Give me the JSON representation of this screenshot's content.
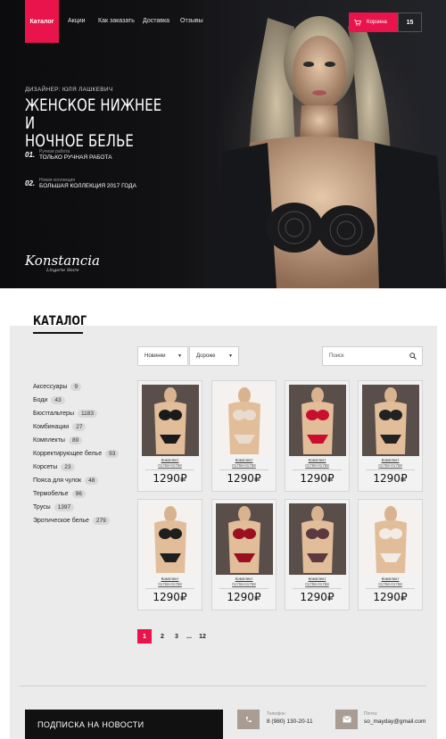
{
  "nav": {
    "catalog": "Каталог",
    "links": [
      "Акции",
      "Как заказать",
      "Доставка",
      "Отзывы"
    ],
    "cart_label": "Корзина",
    "cart_count": "15"
  },
  "hero": {
    "designer": "ДИЗАЙНЕР: ЮЛЯ ЛАШКЕВИЧ",
    "title_line1": "ЖЕНСКОЕ НИЖНЕЕ И",
    "title_line2": "НОЧНОЕ БЕЛЬЕ",
    "features": [
      {
        "num": "01.",
        "small": "Ручная работа",
        "big": "ТОЛЬКО РУЧНАЯ РАБОТА"
      },
      {
        "num": "02.",
        "small": "Новая коллекция",
        "big": "БОЛЬШАЯ КОЛЛЕКЦИЯ 2017 ГОДА"
      }
    ],
    "logo": "Konstancia",
    "logo_sub": "Lingerie Store"
  },
  "catalog": {
    "heading": "КАТАЛОГ",
    "sort1": "Новинки",
    "sort2": "Дороже",
    "search_placeholder": "Поиск",
    "categories": [
      {
        "label": "Аксессуары",
        "count": "9"
      },
      {
        "label": "Боди",
        "count": "43"
      },
      {
        "label": "Бюстгальтеры",
        "count": "1183"
      },
      {
        "label": "Комбинации",
        "count": "27"
      },
      {
        "label": "Комплекты",
        "count": "89"
      },
      {
        "label": "Корректирующее белье",
        "count": "93"
      },
      {
        "label": "Корсеты",
        "count": "23"
      },
      {
        "label": "Пояса для чулок",
        "count": "48"
      },
      {
        "label": "Термобелье",
        "count": "96"
      },
      {
        "label": "Трусы",
        "count": "1397"
      },
      {
        "label": "Эротическое белье",
        "count": "279"
      }
    ],
    "products": [
      {
        "name": "Комплект",
        "sku": "01758-01758",
        "price": "1290₽",
        "color": "#1a1a1a"
      },
      {
        "name": "Комплект",
        "sku": "01758-01758",
        "price": "1290₽",
        "color": "#e9dccf"
      },
      {
        "name": "Комплект",
        "sku": "01758-01758",
        "price": "1290₽",
        "color": "#c8102e"
      },
      {
        "name": "Комплект",
        "sku": "01758-01758",
        "price": "1290₽",
        "color": "#222222"
      },
      {
        "name": "Комплект",
        "sku": "01758-01758",
        "price": "1290₽",
        "color": "#1e1e1e"
      },
      {
        "name": "Комплект",
        "sku": "01758-01758",
        "price": "1290₽",
        "color": "#9b1020"
      },
      {
        "name": "Комплект",
        "sku": "01758-01758",
        "price": "1290₽",
        "color": "#5b3a3f"
      },
      {
        "name": "Комплект",
        "sku": "01758-01758",
        "price": "1290₽",
        "color": "#f1ece6"
      }
    ],
    "pages": [
      "1",
      "2",
      "3",
      "...",
      "12"
    ]
  },
  "footer": {
    "subscribe": "ПОДПИСКА НА НОВОСТИ",
    "phone_label": "Телефон",
    "phone": "8 (980) 130-20-11",
    "email_label": "Почта:",
    "email": "so_mayday@gmail.com"
  },
  "colors": {
    "accent": "#e8144b",
    "dark": "#111111",
    "panel": "#ebebeb",
    "contact_icon": "#a99c93"
  }
}
